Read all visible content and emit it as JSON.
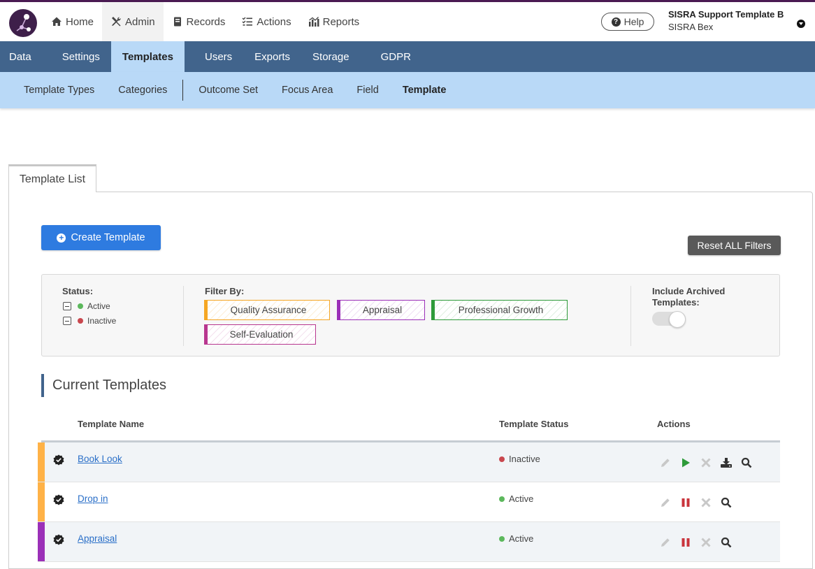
{
  "header": {
    "nav": [
      {
        "label": "Home",
        "icon": "home-icon"
      },
      {
        "label": "Admin",
        "icon": "tools-icon"
      },
      {
        "label": "Records",
        "icon": "book-icon"
      },
      {
        "label": "Actions",
        "icon": "list-icon"
      },
      {
        "label": "Reports",
        "icon": "chart-icon"
      }
    ],
    "active_nav": "Admin",
    "help_label": "Help",
    "user_name": "SISRA Support Template B",
    "user_sub": "SISRA Bex"
  },
  "subnav": {
    "items": [
      "Data",
      "Settings",
      "Templates",
      "Users",
      "Exports",
      "Storage",
      "GDPR"
    ],
    "active": "Templates"
  },
  "tertiary_nav": {
    "items": [
      "Template Types",
      "Categories",
      "Outcome Set",
      "Focus Area",
      "Field",
      "Template"
    ],
    "active": "Template"
  },
  "tab_label": "Template List",
  "create_button": "Create Template",
  "reset_button": "Reset ALL Filters",
  "filters": {
    "status_title": "Status:",
    "status_active": "Active",
    "status_inactive": "Inactive",
    "filter_by_title": "Filter By:",
    "chips": [
      {
        "label": "Quality Assurance",
        "color": "#f5a623"
      },
      {
        "label": "Appraisal",
        "color": "#9b30b8"
      },
      {
        "label": "Professional Growth",
        "color": "#2e9b3a"
      },
      {
        "label": "Self-Evaluation",
        "color": "#b8368f"
      }
    ],
    "archived_title_line1": "Include Archived",
    "archived_title_line2": "Templates:",
    "include_archived": false
  },
  "section_title": "Current Templates",
  "table": {
    "columns": [
      "Template Name",
      "Template Status",
      "Actions"
    ],
    "rows": [
      {
        "name": "Book Look",
        "status": "Inactive",
        "band": "#ffb247",
        "actions": [
          "edit-icon",
          "play-icon",
          "delete-icon",
          "download-icon",
          "search-icon"
        ]
      },
      {
        "name": "Drop in",
        "status": "Active",
        "band": "#ffb247",
        "actions": [
          "edit-icon",
          "pause-icon",
          "delete-icon",
          "search-icon"
        ]
      },
      {
        "name": "Appraisal",
        "status": "Active",
        "band": "#9b30b8",
        "actions": [
          "edit-icon",
          "pause-icon",
          "delete-icon",
          "search-icon"
        ]
      }
    ]
  },
  "colors": {
    "active_dot": "#5cb85c",
    "inactive_dot": "#c9474e",
    "primary": "#2e7be0",
    "subnav_bg": "#41648c",
    "tertiary_bg": "#b9d9f7"
  }
}
